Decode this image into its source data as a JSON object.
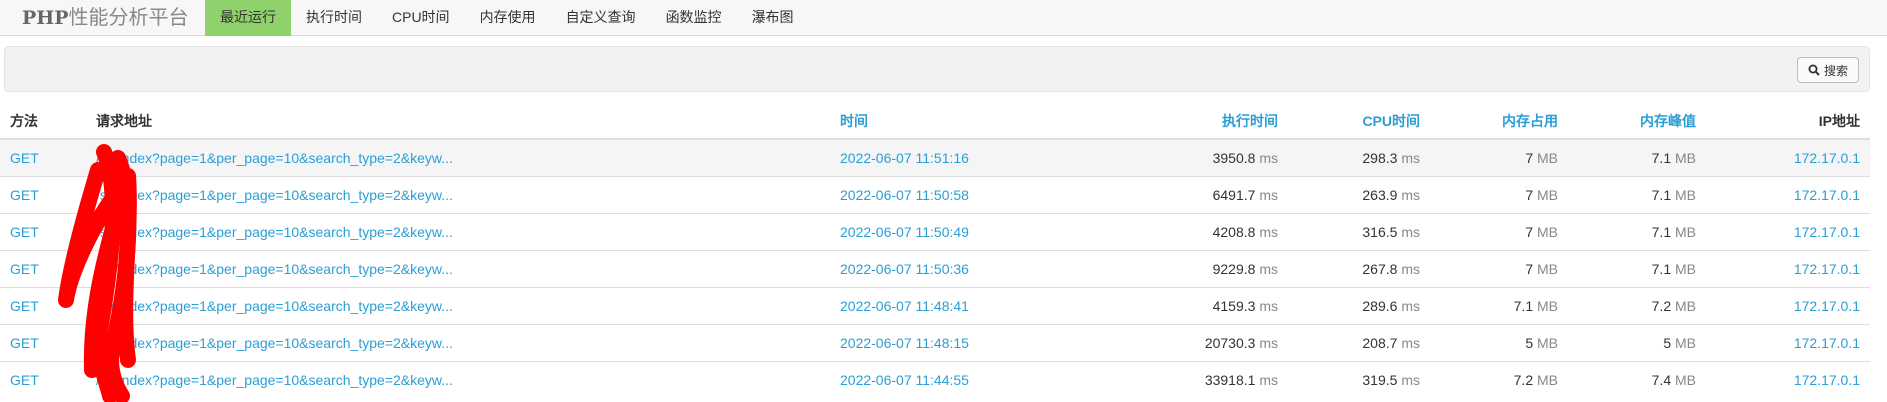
{
  "brand": {
    "bold": "PHP",
    "rest": "性能分析平台"
  },
  "nav": [
    "最近运行",
    "执行时间",
    "CPU时间",
    "内存使用",
    "自定义查询",
    "函数监控",
    "瀑布图"
  ],
  "nav_active": 0,
  "search": {
    "label": "搜索",
    "icon": "search-icon"
  },
  "table": {
    "headers": [
      "方法",
      "请求地址",
      "时间",
      "执行时间",
      "CPU时间",
      "内存占用",
      "内存峰值",
      "IP地址"
    ],
    "rows": [
      {
        "method": "GET",
        "url": "/sa/index?page=1&per_page=10&search_type=2&keyw...",
        "time": "2022-06-07 11:51:16",
        "wt": "3950.8",
        "wt_unit": "ms",
        "cpu": "298.3",
        "cpu_unit": "ms",
        "mu": "7",
        "mu_unit": "MB",
        "pmu": "7.1",
        "pmu_unit": "MB",
        "ip": "172.17.0.1"
      },
      {
        "method": "GET",
        "url": "/sa/index?page=1&per_page=10&search_type=2&keyw...",
        "time": "2022-06-07 11:50:58",
        "wt": "6491.7",
        "wt_unit": "ms",
        "cpu": "263.9",
        "cpu_unit": "ms",
        "mu": "7",
        "mu_unit": "MB",
        "pmu": "7.1",
        "pmu_unit": "MB",
        "ip": "172.17.0.1"
      },
      {
        "method": "GET",
        "url": "/sa/index?page=1&per_page=10&search_type=2&keyw...",
        "time": "2022-06-07 11:50:49",
        "wt": "4208.8",
        "wt_unit": "ms",
        "cpu": "316.5",
        "cpu_unit": "ms",
        "mu": "7",
        "mu_unit": "MB",
        "pmu": "7.1",
        "pmu_unit": "MB",
        "ip": "172.17.0.1"
      },
      {
        "method": "GET",
        "url": "/sa/index?page=1&per_page=10&search_type=2&keyw...",
        "time": "2022-06-07 11:50:36",
        "wt": "9229.8",
        "wt_unit": "ms",
        "cpu": "267.8",
        "cpu_unit": "ms",
        "mu": "7",
        "mu_unit": "MB",
        "pmu": "7.1",
        "pmu_unit": "MB",
        "ip": "172.17.0.1"
      },
      {
        "method": "GET",
        "url": "/sa/index?page=1&per_page=10&search_type=2&keyw...",
        "time": "2022-06-07 11:48:41",
        "wt": "4159.3",
        "wt_unit": "ms",
        "cpu": "289.6",
        "cpu_unit": "ms",
        "mu": "7.1",
        "mu_unit": "MB",
        "pmu": "7.2",
        "pmu_unit": "MB",
        "ip": "172.17.0.1"
      },
      {
        "method": "GET",
        "url": "/sa/index?page=1&per_page=10&search_type=2&keyw...",
        "time": "2022-06-07 11:48:15",
        "wt": "20730.3",
        "wt_unit": "ms",
        "cpu": "208.7",
        "cpu_unit": "ms",
        "mu": "5",
        "mu_unit": "MB",
        "pmu": "5",
        "pmu_unit": "MB",
        "ip": "172.17.0.1"
      },
      {
        "method": "GET",
        "url": "/sa/index?page=1&per_page=10&search_type=2&keyw...",
        "time": "2022-06-07 11:44:55",
        "wt": "33918.1",
        "wt_unit": "ms",
        "cpu": "319.5",
        "cpu_unit": "ms",
        "mu": "7.2",
        "mu_unit": "MB",
        "pmu": "7.4",
        "pmu_unit": "MB",
        "ip": "172.17.0.1"
      }
    ]
  },
  "colors": {
    "accent": "#2a9fd6",
    "active_tab": "#8fd16a",
    "redaction": "#ff0000"
  }
}
